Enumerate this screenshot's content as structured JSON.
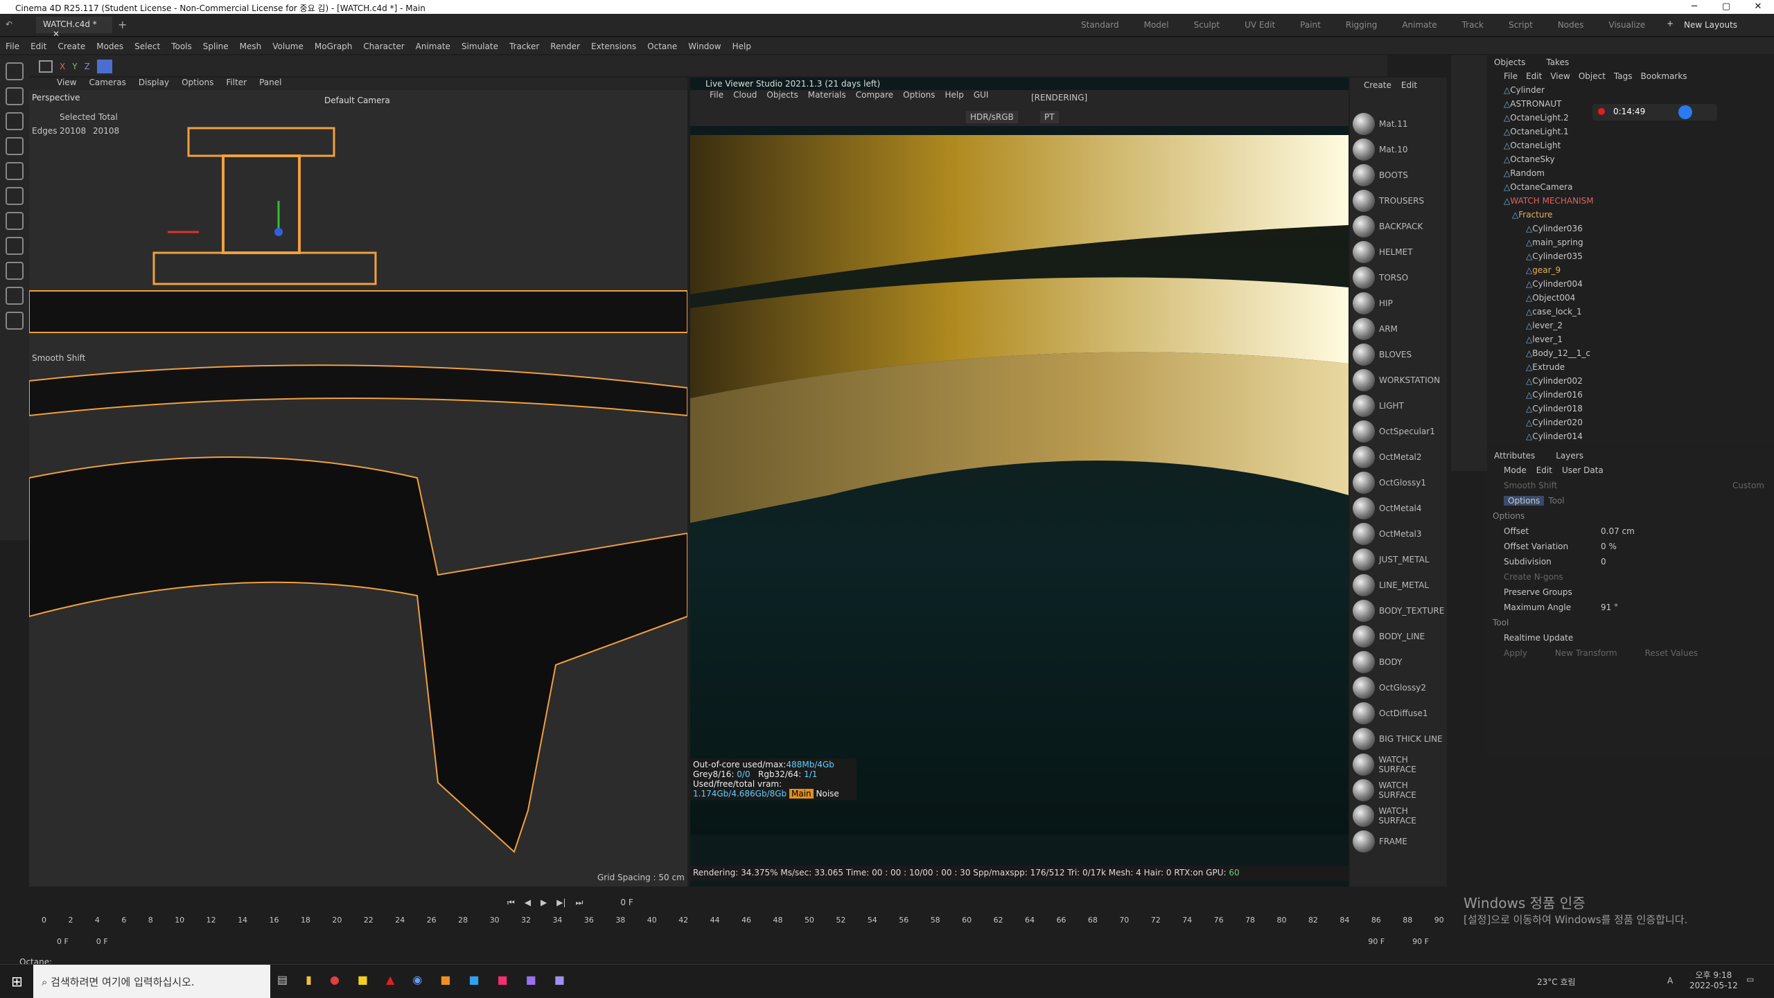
{
  "window": {
    "title": "Cinema 4D R25.117 (Student License - Non-Commercial License for 중요 김) - [WATCH.c4d *] - Main",
    "doc_tab": "WATCH.c4d *"
  },
  "layouts": [
    "Standard",
    "Model",
    "Sculpt",
    "UV Edit",
    "Paint",
    "Rigging",
    "Animate",
    "Track",
    "Script",
    "Nodes",
    "Visualize"
  ],
  "new_layouts": "New Layouts",
  "menu": [
    "File",
    "Edit",
    "Create",
    "Modes",
    "Select",
    "Tools",
    "Spline",
    "Mesh",
    "Volume",
    "MoGraph",
    "Character",
    "Animate",
    "Simulate",
    "Tracker",
    "Render",
    "Extensions",
    "Octane",
    "Window",
    "Help"
  ],
  "viewport": {
    "menu": [
      "View",
      "Cameras",
      "Display",
      "Options",
      "Filter",
      "Panel"
    ],
    "perspective": "Perspective",
    "camera": "Default Camera",
    "selected_total": "Selected Total",
    "edges_label": "Edges",
    "edges_a": "20108",
    "edges_b": "20108",
    "tool": "Smooth Shift",
    "grid": "Grid Spacing : 50 cm"
  },
  "liveviewer": {
    "title": "Live Viewer Studio 2021.1.3 (21 days left)",
    "menu": [
      "File",
      "Cloud",
      "Objects",
      "Materials",
      "Compare",
      "Options",
      "Help",
      "GUI"
    ],
    "status": "[RENDERING]",
    "colorspace": "HDR/sRGB",
    "mode": "PT",
    "stat1": "Out-of-core used/max:",
    "stat1v": "488Mb/4Gb",
    "stat2": "Grey8/16:",
    "stat2v": "0/0",
    "stat3": "Rgb32/64:",
    "stat3v": "1/1",
    "stat4": "Used/free/total vram:",
    "stat4v": "1.174Gb/4.686Gb/8Gb",
    "main": "Main",
    "noise": "Noise",
    "bottom": "Rendering: 34.375%  Ms/sec: 33.065   Time: 00 : 00 : 10/00 : 00 : 30    Spp/maxspp: 176/512   Tri: 0/17k   Mesh: 4  Hair: 0   RTX:on    GPU:",
    "gpu": "60"
  },
  "materials_header": [
    "Create",
    "Edit"
  ],
  "materials": [
    "Mat.11",
    "Mat.10",
    "BOOTS",
    "TROUSERS",
    "BACKPACK",
    "HELMET",
    "TORSO",
    "HIP",
    "ARM",
    "BLOVES",
    "WORKSTATION",
    "LIGHT",
    "OctSpecular1",
    "OctMetal2",
    "OctGlossy1",
    "OctMetal4",
    "OctMetal3",
    "JUST_METAL",
    "LINE_METAL",
    "BODY_TEXTURE",
    "BODY_LINE",
    "BODY",
    "OctGlossy2",
    "OctDiffuse1",
    "BIG THICK LINE",
    "WATCH SURFACE",
    "WATCH SURFACE",
    "WATCH SURFACE",
    "FRAME"
  ],
  "objects_tabs": [
    "Objects",
    "Takes"
  ],
  "objects_menu": [
    "File",
    "Edit",
    "View",
    "Object",
    "Tags",
    "Bookmarks"
  ],
  "recording_time": "0:14:49",
  "objects": [
    "Cylinder",
    "ASTRONAUT",
    "OctaneLight.2",
    "OctaneLight.1",
    "OctaneLight",
    "OctaneSky",
    "Random",
    "OctaneCamera",
    "WATCH MECHANISM",
    "Fracture",
    "Cylinder036",
    "main_spring",
    "Cylinder035",
    "gear_9",
    "Cylinder004",
    "Object004",
    "case_lock_1",
    "lever_2",
    "lever_1",
    "Body_12__1_c",
    "Extrude",
    "Cylinder002",
    "Cylinder016",
    "Cylinder018",
    "Cylinder020",
    "Cylinder014"
  ],
  "attributes": {
    "tabs": [
      "Attributes",
      "Layers"
    ],
    "menu": [
      "Mode",
      "Edit",
      "User Data"
    ],
    "tool": "Smooth Shift",
    "custom": "Custom",
    "subtabs": [
      "Options",
      "Tool"
    ],
    "section_options": "Options",
    "offset": "Offset",
    "offset_v": "0.07 cm",
    "offset_var": "Offset Variation",
    "offset_var_v": "0 %",
    "subdiv": "Subdivision",
    "subdiv_v": "0",
    "ngons": "Create N-gons",
    "preserve": "Preserve Groups",
    "maxangle": "Maximum Angle",
    "maxangle_v": "91 °",
    "section_tool": "Tool",
    "realtime": "Realtime Update",
    "apply": "Apply",
    "newtransform": "New Transform",
    "reset": "Reset Values"
  },
  "timeline": {
    "frame": "0 F",
    "ticks": [
      "0",
      "2",
      "4",
      "6",
      "8",
      "10",
      "12",
      "14",
      "16",
      "18",
      "20",
      "22",
      "24",
      "26",
      "28",
      "30",
      "32",
      "34",
      "36",
      "38",
      "40",
      "42",
      "44",
      "46",
      "48",
      "50",
      "52",
      "54",
      "56",
      "58",
      "60",
      "62",
      "64",
      "66",
      "68",
      "70",
      "72",
      "74",
      "76",
      "78",
      "80",
      "82",
      "84",
      "86",
      "88",
      "90"
    ],
    "start": "0 F",
    "start2": "0 F",
    "end": "90 F",
    "end2": "90 F"
  },
  "statusline": "Octane:",
  "watermark": {
    "line1": "Windows 정품 인증",
    "line2": "[설정]으로 이동하여 Windows를 정품 인증합니다."
  },
  "taskbar": {
    "search": "검색하려면 여기에 입력하십시오.",
    "weather": "23°C  흐림",
    "time": "오후 9:18",
    "date": "2022-05-12",
    "ime": "A"
  }
}
